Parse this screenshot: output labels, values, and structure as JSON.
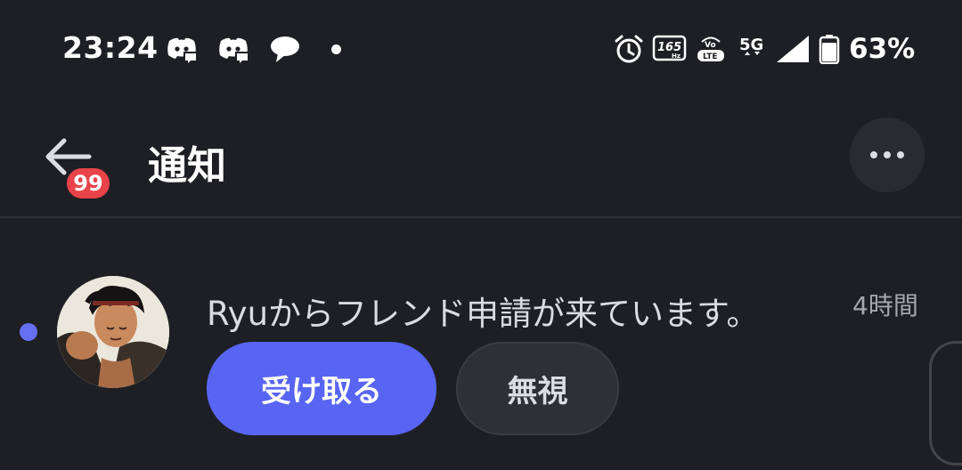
{
  "status_bar": {
    "time": "23:24",
    "left_icons": [
      "discord-icon",
      "discord-icon",
      "chat-bubble-icon",
      "dot-icon"
    ],
    "right_icons": [
      "alarm-icon",
      "refresh-rate-icon",
      "volte-icon",
      "5g-icon",
      "signal-icon",
      "battery-icon"
    ],
    "refresh_rate_label": "165",
    "refresh_rate_unit": "Hz",
    "volte_top": "Vo",
    "volte_bottom": "LTE",
    "network": "5G",
    "battery_percent": "63%",
    "battery_level": 0.63
  },
  "header": {
    "title": "通知",
    "badge_count": "99"
  },
  "notification": {
    "message": "Ryuからフレンド申請が来ています。",
    "time": "4時間",
    "accept_label": "受け取る",
    "ignore_label": "無視"
  },
  "colors": {
    "background": "#1e1f24",
    "accent": "#5865f2",
    "badge": "#e9434a",
    "unread_dot": "#6570f0"
  }
}
